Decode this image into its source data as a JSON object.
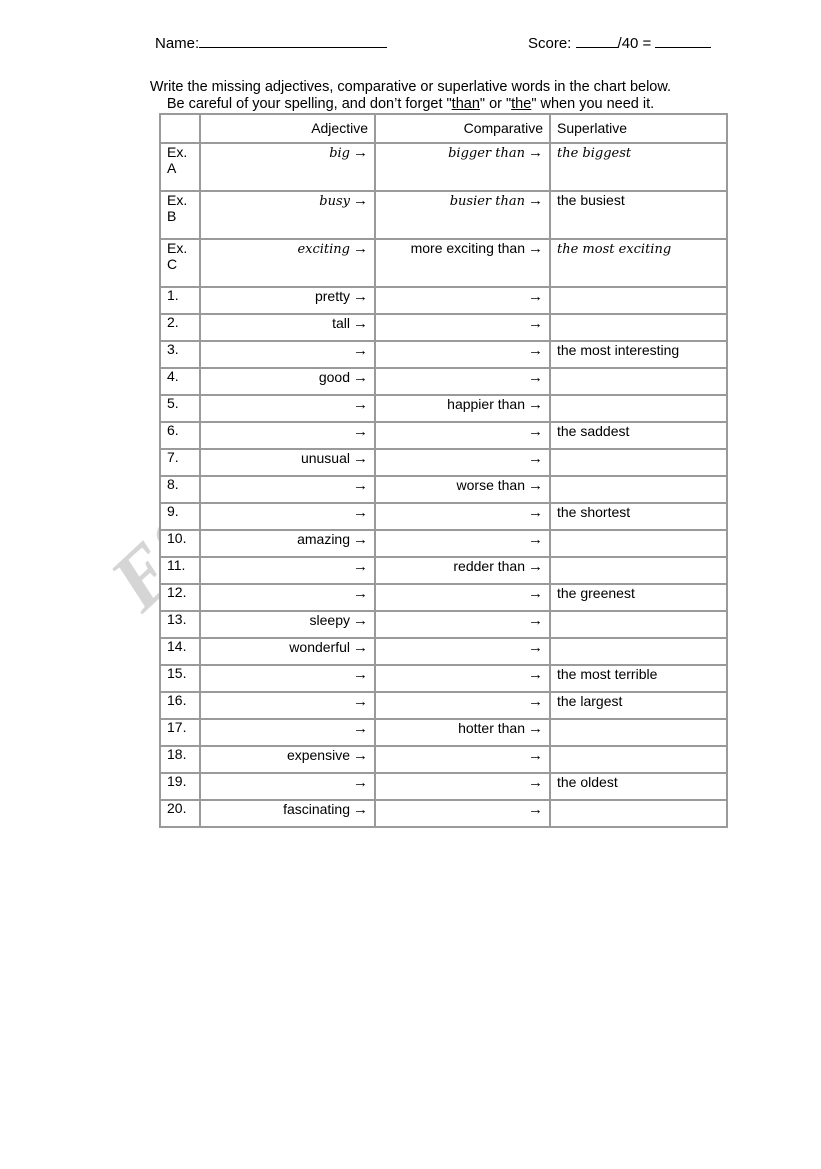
{
  "header": {
    "name_label": "Name:",
    "score_label": "Score:",
    "score_denominator": "/40 =",
    "name_blank": "",
    "score_blank_1": "",
    "score_blank_2": ""
  },
  "instructions": {
    "line1": "Write the missing adjectives, comparative or superlative words in the chart below.",
    "line2_a": "Be careful of your spelling, and don’t forget \"",
    "line2_than": "than",
    "line2_b": "\" or \"",
    "line2_the": "the",
    "line2_c": "\" when you need it."
  },
  "chart": {
    "columns": {
      "number": "",
      "adjective": "Adjective",
      "comparative": "Comparative",
      "superlative": "Superlative"
    },
    "arrow_glyph": "→",
    "shade_color": "#c6c6c6",
    "border_color": "#9a9a9a",
    "examples": [
      {
        "number": "Ex. A",
        "adjective": "big",
        "adjective_script": true,
        "comparative": "bigger than",
        "comparative_script": true,
        "superlative": "the biggest",
        "superlative_script": true
      },
      {
        "number": "Ex. B",
        "adjective": "busy",
        "adjective_script": true,
        "comparative": "busier than",
        "comparative_script": true,
        "superlative": "the busiest",
        "superlative_script": false
      },
      {
        "number": "Ex. C",
        "adjective": "exciting",
        "adjective_script": true,
        "comparative": "more exciting than",
        "comparative_script": false,
        "superlative": "the most exciting",
        "superlative_script": true
      }
    ],
    "rows": [
      {
        "number": "1.",
        "adjective": "pretty",
        "comparative": "",
        "superlative": ""
      },
      {
        "number": "2.",
        "adjective": "tall",
        "comparative": "",
        "superlative": ""
      },
      {
        "number": "3.",
        "adjective": "",
        "comparative": "",
        "superlative": "the most interesting"
      },
      {
        "number": "4.",
        "adjective": "good",
        "comparative": "",
        "superlative": ""
      },
      {
        "number": "5.",
        "adjective": "",
        "comparative": "happier than",
        "superlative": ""
      },
      {
        "number": "6.",
        "adjective": "",
        "comparative": "",
        "superlative": "the saddest"
      },
      {
        "number": "7.",
        "adjective": "unusual",
        "comparative": "",
        "superlative": ""
      },
      {
        "number": "8.",
        "adjective": "",
        "comparative": "worse than",
        "superlative": ""
      },
      {
        "number": "9.",
        "adjective": "",
        "comparative": "",
        "superlative": "the shortest"
      },
      {
        "number": "10.",
        "adjective": "amazing",
        "comparative": "",
        "superlative": ""
      },
      {
        "number": "11.",
        "adjective": "",
        "comparative": "redder than",
        "superlative": ""
      },
      {
        "number": "12.",
        "adjective": "",
        "comparative": "",
        "superlative": "the greenest"
      },
      {
        "number": "13.",
        "adjective": "sleepy",
        "comparative": "",
        "superlative": ""
      },
      {
        "number": "14.",
        "adjective": "wonderful",
        "comparative": "",
        "superlative": ""
      },
      {
        "number": "15.",
        "adjective": "",
        "comparative": "",
        "superlative": "the most terrible"
      },
      {
        "number": "16.",
        "adjective": "",
        "comparative": "",
        "superlative": "the largest"
      },
      {
        "number": "17.",
        "adjective": "",
        "comparative": "hotter than",
        "superlative": ""
      },
      {
        "number": "18.",
        "adjective": "expensive",
        "comparative": "",
        "superlative": ""
      },
      {
        "number": "19.",
        "adjective": "",
        "comparative": "",
        "superlative": "the oldest"
      },
      {
        "number": "20.",
        "adjective": "fascinating",
        "comparative": "",
        "superlative": ""
      }
    ]
  },
  "watermark": {
    "text": "ESLprintables.com",
    "color": "#9d9d9d"
  }
}
